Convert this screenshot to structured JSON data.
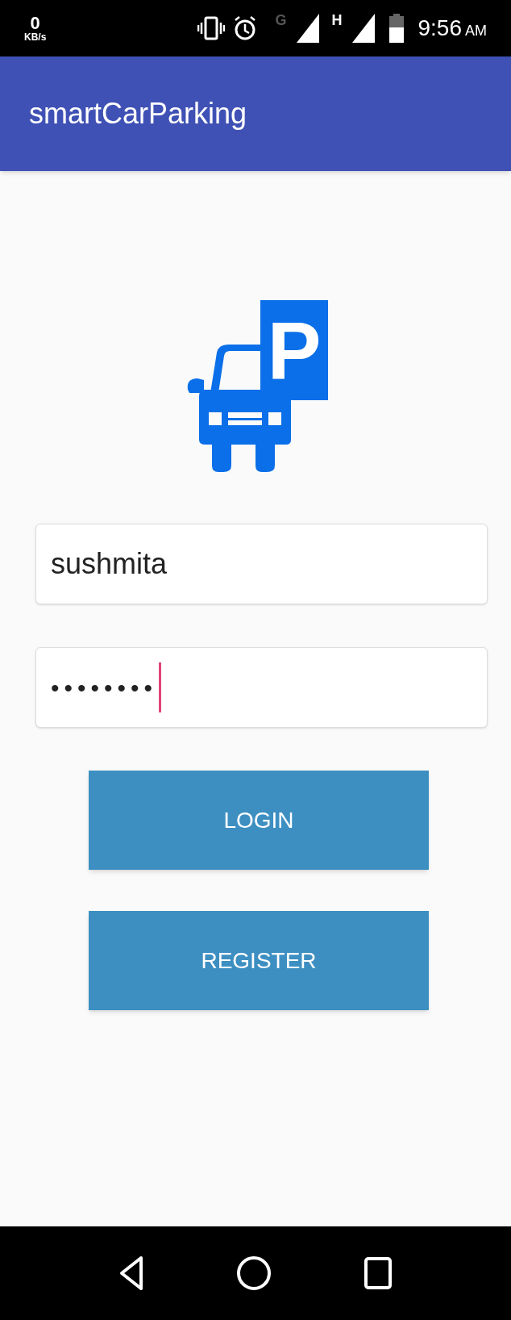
{
  "status_bar": {
    "speed_value": "0",
    "speed_unit": "KB/s",
    "network_1": "G",
    "network_2": "H",
    "time": "9:56",
    "meridiem": "AM"
  },
  "app_bar": {
    "title": "smartCarParking"
  },
  "logo": {
    "sign_letter": "P"
  },
  "fields": [
    {
      "kind": "text",
      "value": "sushmita",
      "focused": false
    },
    {
      "kind": "password",
      "value": "••••••••",
      "focused": true
    }
  ],
  "buttons": [
    "LOGIN",
    "REGISTER"
  ]
}
